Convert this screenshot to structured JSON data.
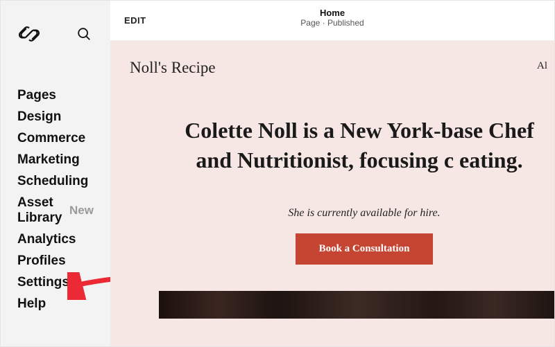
{
  "sidebar": {
    "items": [
      {
        "label": "Pages"
      },
      {
        "label": "Design"
      },
      {
        "label": "Commerce"
      },
      {
        "label": "Marketing"
      },
      {
        "label": "Scheduling"
      },
      {
        "label": "Asset Library",
        "badge": "New"
      },
      {
        "label": "Analytics"
      },
      {
        "label": "Profiles"
      },
      {
        "label": "Settings"
      },
      {
        "label": "Help"
      }
    ]
  },
  "topbar": {
    "edit_label": "EDIT",
    "page_title": "Home",
    "page_status": "Page · Published"
  },
  "preview": {
    "site_title": "Noll's Recipe",
    "nav_right_partial": "Al",
    "hero_heading": "Colette Noll is a New York-base Chef and Nutritionist, focusing c eating.",
    "hero_sub": "She is currently available for hire.",
    "cta_label": "Book a Consultation"
  },
  "colors": {
    "sidebar_bg": "#f3f3f3",
    "preview_bg": "#f6e7e4",
    "accent": "#c64432",
    "arrow": "#eb2a36"
  }
}
